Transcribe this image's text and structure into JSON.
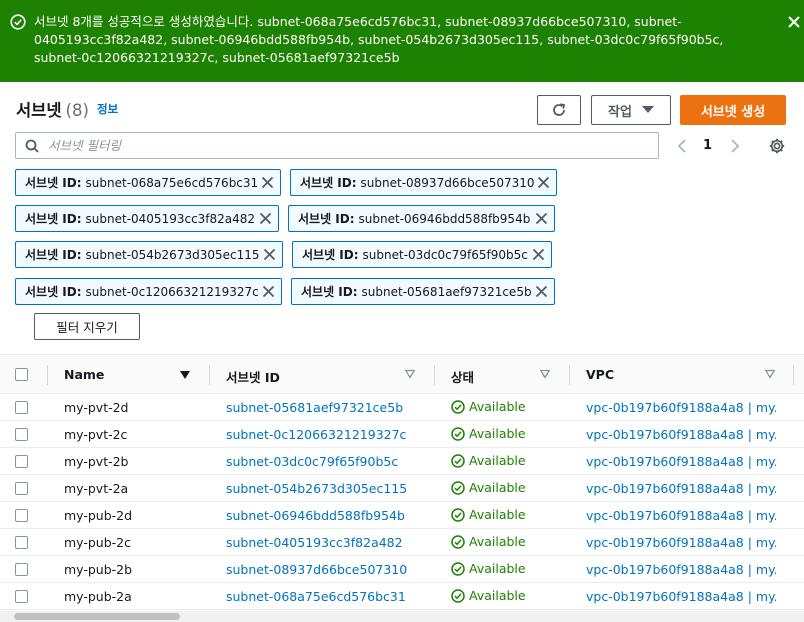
{
  "banner": {
    "message": "서브넷 8개를 성공적으로 생성하였습니다. subnet-068a75e6cd576bc31, subnet-08937d66bce507310, subnet-0405193cc3f82a482, subnet-06946bdd588fb954b, subnet-054b2673d305ec115, subnet-03dc0c79f65f90b5c, subnet-0c12066321219327c, subnet-05681aef97321ce5b",
    "color": "#1d8102"
  },
  "header": {
    "title": "서브넷",
    "count": "(8)",
    "info": "정보",
    "actions_label": "작업",
    "create_label": "서브넷 생성",
    "accent": "#ec7211"
  },
  "search": {
    "placeholder": "서브넷 필터링",
    "value": ""
  },
  "pager": {
    "page": "1"
  },
  "filters": [
    {
      "key": "서브넷 ID:",
      "value": "subnet-068a75e6cd576bc31"
    },
    {
      "key": "서브넷 ID:",
      "value": "subnet-08937d66bce507310"
    },
    {
      "key": "서브넷 ID:",
      "value": "subnet-0405193cc3f82a482"
    },
    {
      "key": "서브넷 ID:",
      "value": "subnet-06946bdd588fb954b"
    },
    {
      "key": "서브넷 ID:",
      "value": "subnet-054b2673d305ec115"
    },
    {
      "key": "서브넷 ID:",
      "value": "subnet-03dc0c79f65f90b5c"
    },
    {
      "key": "서브넷 ID:",
      "value": "subnet-0c12066321219327c"
    },
    {
      "key": "서브넷 ID:",
      "value": "subnet-05681aef97321ce5b"
    }
  ],
  "clear_filters_label": "필터 지우기",
  "table": {
    "columns": [
      "Name",
      "서브넷 ID",
      "상태",
      "VPC"
    ],
    "rows": [
      {
        "name": "my-pvt-2d",
        "subnet_id": "subnet-05681aef97321ce5b",
        "state": "Available",
        "vpc": "vpc-0b197b60f9188a4a8 | my..."
      },
      {
        "name": "my-pvt-2c",
        "subnet_id": "subnet-0c12066321219327c",
        "state": "Available",
        "vpc": "vpc-0b197b60f9188a4a8 | my..."
      },
      {
        "name": "my-pvt-2b",
        "subnet_id": "subnet-03dc0c79f65f90b5c",
        "state": "Available",
        "vpc": "vpc-0b197b60f9188a4a8 | my..."
      },
      {
        "name": "my-pvt-2a",
        "subnet_id": "subnet-054b2673d305ec115",
        "state": "Available",
        "vpc": "vpc-0b197b60f9188a4a8 | my..."
      },
      {
        "name": "my-pub-2d",
        "subnet_id": "subnet-06946bdd588fb954b",
        "state": "Available",
        "vpc": "vpc-0b197b60f9188a4a8 | my..."
      },
      {
        "name": "my-pub-2c",
        "subnet_id": "subnet-0405193cc3f82a482",
        "state": "Available",
        "vpc": "vpc-0b197b60f9188a4a8 | my..."
      },
      {
        "name": "my-pub-2b",
        "subnet_id": "subnet-08937d66bce507310",
        "state": "Available",
        "vpc": "vpc-0b197b60f9188a4a8 | my..."
      },
      {
        "name": "my-pub-2a",
        "subnet_id": "subnet-068a75e6cd576bc31",
        "state": "Available",
        "vpc": "vpc-0b197b60f9188a4a8 | my..."
      }
    ]
  },
  "icons": {
    "success": "check-circle-icon",
    "close": "close-icon",
    "refresh": "refresh-icon",
    "dropdown": "caret-down-icon",
    "search": "search-icon",
    "settings": "gear-icon"
  }
}
